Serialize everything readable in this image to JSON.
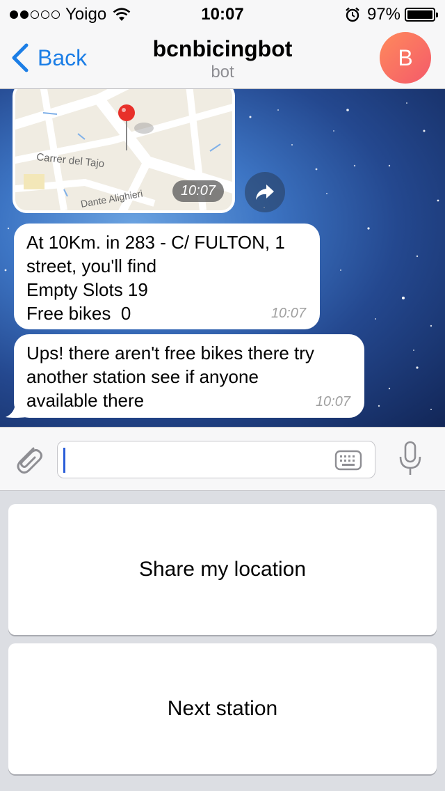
{
  "status_bar": {
    "carrier": "Yoigo",
    "time": "10:07",
    "battery": "97%"
  },
  "nav": {
    "back_label": "Back",
    "title": "bcnbicingbot",
    "subtitle": "bot",
    "avatar_letter": "B"
  },
  "chat": {
    "map_message": {
      "street_labels": [
        "Carrer del Tajo",
        "Dante Alighieri"
      ],
      "time": "10:07"
    },
    "messages": [
      {
        "lines": [
          "At 10Km. in 283 - C/ FULTON, 1",
          "street, you'll find",
          "Empty Slots 19",
          "Free bikes  0"
        ],
        "time": "10:07"
      },
      {
        "lines": [
          "Ups! there aren't free bikes there try",
          "another station see if anyone",
          "available there"
        ],
        "time": "10:07"
      }
    ]
  },
  "input": {
    "placeholder": ""
  },
  "reply_keyboard": {
    "buttons": [
      "Share my location",
      "Next station"
    ]
  },
  "colors": {
    "accent": "#1c7ee6",
    "avatar_gradient_start": "#ff8a5c",
    "avatar_gradient_end": "#f45a6a",
    "map_pin": "#e8302a"
  }
}
